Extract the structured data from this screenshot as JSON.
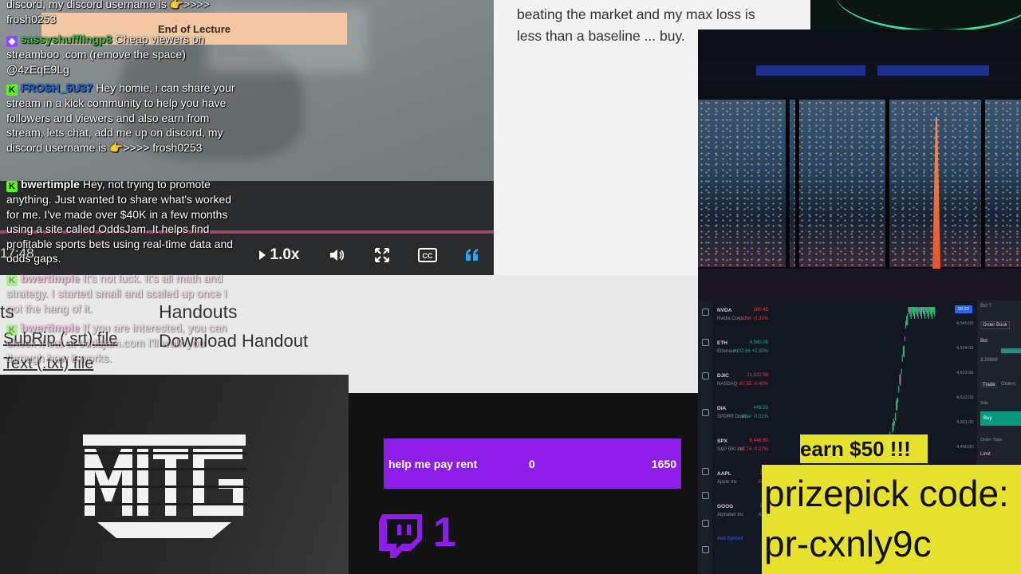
{
  "video": {
    "banner": "End of Lecture",
    "time": "17:48",
    "speed": "1.0x"
  },
  "chat": {
    "messages": [
      {
        "user": "",
        "text": "discord, my discord username is 👉>>>> frosh0253"
      },
      {
        "user": "sassyshufflingp8",
        "text": "Cheap viewers on streamboo .com (remove the space) @4zEqE9Lg"
      },
      {
        "user": "FROSH_5U37",
        "text": "Hey homie, i can share your stream in a kick community to help you have followers and viewers and also earn from stream, lets chat, add me up on discord, my discord username is 👉>>>> frosh0253"
      },
      {
        "user": "bwertimple",
        "text": "Hey, not trying to promote anything. Just wanted to share what's worked for me. I've made over $40K in a few months using a site called OddsJam. It helps find profitable sports bets using real-time data and odds gaps."
      },
      {
        "user": "bwertimple",
        "text": "It's not luck. It's all math and strategy. I started small and scaled up once I got the hang of it."
      },
      {
        "user": "bwertimple",
        "text": "If you are interested, you can check it out at oddsjam.com I'll walk you through how it works."
      }
    ]
  },
  "handouts": {
    "fragment": "ts",
    "heading": "Handouts",
    "download": "Download Handout",
    "srt": "SubRip (.srt) file",
    "txt": "Text (.txt) file"
  },
  "article": {
    "text": "beating the market and my max loss is less than a baseline ... buy."
  },
  "stocks": {
    "watchlist": [
      {
        "sym": "NVDA",
        "name": "Nvidia Corp...",
        "price": "180.45",
        "chg": "After -0.31%",
        "dir": "down"
      },
      {
        "sym": "ETH",
        "name": "Ethereum",
        "price": "4,560.08",
        "chg": "+102.66 +2.30%",
        "dir": "up"
      },
      {
        "sym": "DJIC",
        "name": "NASDAQ",
        "price": "21,622.98",
        "chg": "-87.55 -0.40%",
        "dir": "down"
      },
      {
        "sym": "DIA",
        "name": "SPDR® Dow...",
        "price": "449.53",
        "chg": "After -0.01%",
        "dir": "up"
      },
      {
        "sym": "SPX",
        "name": "S&P 500 Ind...",
        "price": "6,448.80",
        "chg": "-17.74 -0.27%",
        "dir": "down"
      },
      {
        "sym": "AAPL",
        "name": "Apple Inc",
        "price": "231",
        "chg": "After",
        "dir": "down"
      },
      {
        "sym": "GOOG",
        "name": "Alphabet Inc",
        "price": "204",
        "chg": "After",
        "dir": "up"
      }
    ],
    "add_symbol": "Add Symbol",
    "last_price": "00:22",
    "yticks": [
      "4,545.00",
      "4,534.00",
      "4,523.00",
      "4,512.00",
      "4,501.00",
      "4,490.00",
      "4,479.00"
    ],
    "order_panel": {
      "book": "Order Book",
      "bid": "Bid",
      "bid_value": "3.28888",
      "trade": "Trade",
      "orders": "Orders",
      "side": "Side",
      "buy": "Buy",
      "order_type": "Order Type",
      "limit": "Limit"
    }
  },
  "promo": {
    "earn": "earn $50 !!!",
    "line1": "prizepick code:",
    "line2": "pr-cxnly9c"
  },
  "goal": {
    "label": "help me pay rent",
    "current": "0",
    "target": "1650"
  },
  "twitch": {
    "count": "1"
  },
  "colors": {
    "kick_green": "#53fc18",
    "twitch_purple": "#8c1ee8",
    "promo_yellow": "#e6e12c"
  }
}
